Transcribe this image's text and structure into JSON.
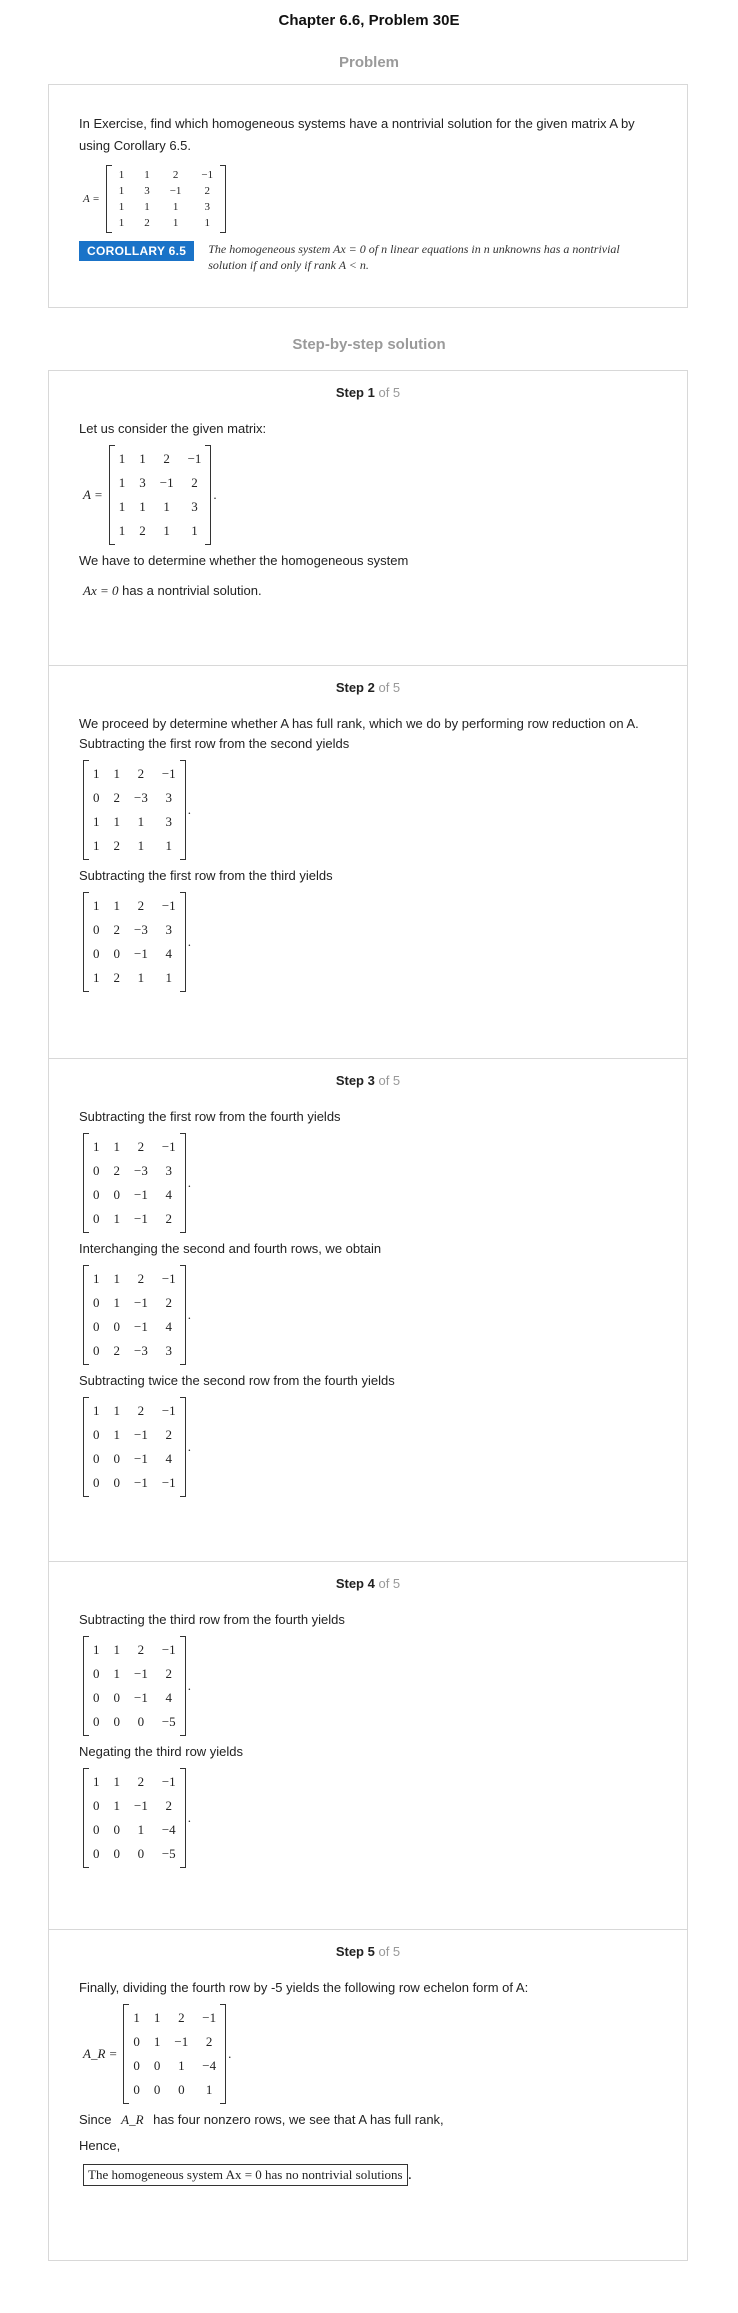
{
  "header": {
    "title": "Chapter 6.6, Problem 30E"
  },
  "problem": {
    "section_title": "Problem",
    "text": "In Exercise, find which homogeneous systems have a nontrivial solution for the given matrix A by using Corollary 6.5.",
    "matrix_label": "A =",
    "matrix": [
      [
        "1",
        "1",
        "2",
        "−1"
      ],
      [
        "1",
        "3",
        "−1",
        "2"
      ],
      [
        "1",
        "1",
        "1",
        "3"
      ],
      [
        "1",
        "2",
        "1",
        "1"
      ]
    ],
    "corollary_label": "COROLLARY 6.5",
    "corollary_text": "The homogeneous system Ax = 0 of n linear equations in n unknowns has a nontrivial solution if and only if rank A < n."
  },
  "solution": {
    "section_title": "Step-by-step solution",
    "of_total": "of 5",
    "steps": [
      {
        "label": "Step 1",
        "text1": "Let us consider the given matrix:",
        "matrix_label": "A =",
        "matrix": [
          [
            "1",
            "1",
            "2",
            "−1"
          ],
          [
            "1",
            "3",
            "−1",
            "2"
          ],
          [
            "1",
            "1",
            "1",
            "3"
          ],
          [
            "1",
            "2",
            "1",
            "1"
          ]
        ],
        "text2": "We have to determine whether the homogeneous system",
        "equation": "Ax = 0",
        "text3": "has a nontrivial solution."
      },
      {
        "label": "Step 2",
        "text1": "We proceed by determine whether A has full rank, which we do by performing row reduction on A. Subtracting the first row from the second yields",
        "matrix1": [
          [
            "1",
            "1",
            "2",
            "−1"
          ],
          [
            "0",
            "2",
            "−3",
            "3"
          ],
          [
            "1",
            "1",
            "1",
            "3"
          ],
          [
            "1",
            "2",
            "1",
            "1"
          ]
        ],
        "text2": "Subtracting the first row from the third yields",
        "matrix2": [
          [
            "1",
            "1",
            "2",
            "−1"
          ],
          [
            "0",
            "2",
            "−3",
            "3"
          ],
          [
            "0",
            "0",
            "−1",
            "4"
          ],
          [
            "1",
            "2",
            "1",
            "1"
          ]
        ]
      },
      {
        "label": "Step 3",
        "text1": "Subtracting the first row from the fourth yields",
        "matrix1": [
          [
            "1",
            "1",
            "2",
            "−1"
          ],
          [
            "0",
            "2",
            "−3",
            "3"
          ],
          [
            "0",
            "0",
            "−1",
            "4"
          ],
          [
            "0",
            "1",
            "−1",
            "2"
          ]
        ],
        "text2": "Interchanging the second and fourth rows, we obtain",
        "matrix2": [
          [
            "1",
            "1",
            "2",
            "−1"
          ],
          [
            "0",
            "1",
            "−1",
            "2"
          ],
          [
            "0",
            "0",
            "−1",
            "4"
          ],
          [
            "0",
            "2",
            "−3",
            "3"
          ]
        ],
        "text3": "Subtracting twice the second row from the fourth yields",
        "matrix3": [
          [
            "1",
            "1",
            "2",
            "−1"
          ],
          [
            "0",
            "1",
            "−1",
            "2"
          ],
          [
            "0",
            "0",
            "−1",
            "4"
          ],
          [
            "0",
            "0",
            "−1",
            "−1"
          ]
        ]
      },
      {
        "label": "Step 4",
        "text1": "Subtracting the third row from the fourth yields",
        "matrix1": [
          [
            "1",
            "1",
            "2",
            "−1"
          ],
          [
            "0",
            "1",
            "−1",
            "2"
          ],
          [
            "0",
            "0",
            "−1",
            "4"
          ],
          [
            "0",
            "0",
            "0",
            "−5"
          ]
        ],
        "text2": "Negating the third row yields",
        "matrix2": [
          [
            "1",
            "1",
            "2",
            "−1"
          ],
          [
            "0",
            "1",
            "−1",
            "2"
          ],
          [
            "0",
            "0",
            "1",
            "−4"
          ],
          [
            "0",
            "0",
            "0",
            "−5"
          ]
        ]
      },
      {
        "label": "Step 5",
        "text1": "Finally, dividing the fourth row by -5 yields the following row echelon form of A:",
        "matrix_label": "A_R =",
        "matrix": [
          [
            "1",
            "1",
            "2",
            "−1"
          ],
          [
            "0",
            "1",
            "−1",
            "2"
          ],
          [
            "0",
            "0",
            "1",
            "−4"
          ],
          [
            "0",
            "0",
            "0",
            "1"
          ]
        ],
        "text2_pre": "Since",
        "text2_sym": "A_R",
        "text2_post": "has four nonzero rows, we see that A has full rank,",
        "text3": "Hence,",
        "conclusion": "The homogeneous system Ax = 0 has no nontrivial solutions"
      }
    ]
  }
}
